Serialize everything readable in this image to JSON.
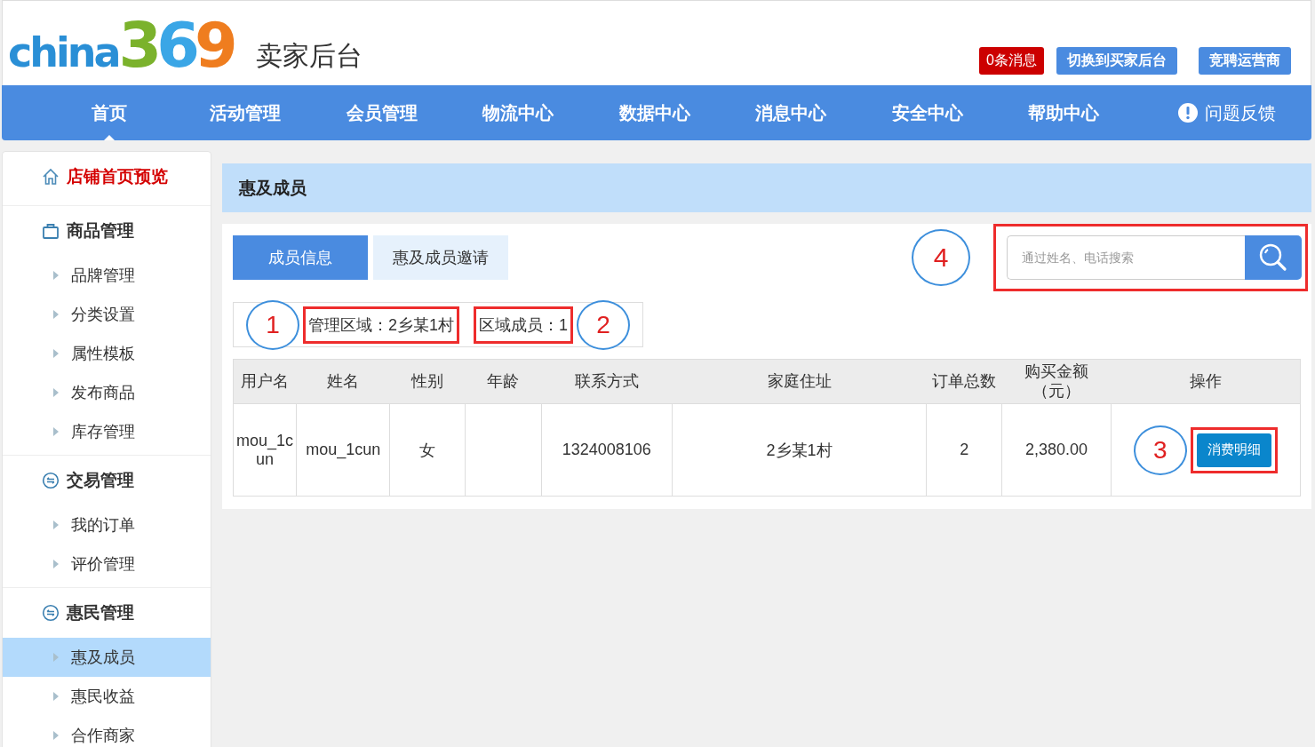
{
  "header": {
    "logo": "china369",
    "title": "卖家后台",
    "buttons": [
      {
        "label": "0条消息",
        "kind": "alert"
      },
      {
        "label": "切换到买家后台",
        "kind": "normal"
      },
      {
        "label": "竞聘运营商",
        "kind": "normal"
      }
    ]
  },
  "nav": {
    "items": [
      {
        "label": "首页",
        "selected": true
      },
      {
        "label": "活动管理",
        "selected": false
      },
      {
        "label": "会员管理",
        "selected": false
      },
      {
        "label": "物流中心",
        "selected": false
      },
      {
        "label": "数据中心",
        "selected": false
      },
      {
        "label": "消息中心",
        "selected": false
      },
      {
        "label": "安全中心",
        "selected": false
      },
      {
        "label": "帮助中心",
        "selected": false
      }
    ],
    "feedback": "问题反馈"
  },
  "sidebar": {
    "sections": [
      {
        "label": "店铺首页预览",
        "kind": "home"
      },
      {
        "label": "商品管理",
        "kind": "bag",
        "children": [
          {
            "label": "品牌管理",
            "selected": false
          },
          {
            "label": "分类设置",
            "selected": false
          },
          {
            "label": "属性模板",
            "selected": false
          },
          {
            "label": "发布商品",
            "selected": false
          },
          {
            "label": "库存管理",
            "selected": false
          }
        ]
      },
      {
        "label": "交易管理",
        "kind": "swap",
        "children": [
          {
            "label": "我的订单",
            "selected": false
          },
          {
            "label": "评价管理",
            "selected": false
          }
        ]
      },
      {
        "label": "惠民管理",
        "kind": "swap",
        "children": [
          {
            "label": "惠及成员",
            "selected": true
          },
          {
            "label": "惠民收益",
            "selected": false
          },
          {
            "label": "合作商家",
            "selected": false
          }
        ]
      }
    ]
  },
  "page_title": "惠及成员",
  "tabs": [
    {
      "label": "成员信息",
      "selected": true
    },
    {
      "label": "惠及成员邀请",
      "selected": false
    }
  ],
  "search": {
    "placeholder": "通过姓名、电话搜索",
    "marker": "4",
    "highlighted": true
  },
  "info": [
    {
      "text": "管理区域：2乡某1村",
      "marker": "1",
      "highlighted": true
    },
    {
      "text": "区域成员：1",
      "marker": "2",
      "highlighted": true
    }
  ],
  "table": {
    "columns": [
      "用户名",
      "姓名",
      "性别",
      "年龄",
      "联系方式",
      "家庭住址",
      "订单总数",
      "购买金额（元）",
      "操作"
    ],
    "rows": [
      {
        "cells": [
          "mou_1cun",
          "mou_1cun",
          "女",
          "",
          "1324008106",
          "2乡某1村",
          "2",
          "2,380.00"
        ],
        "action": "消费明细",
        "marker": "3",
        "highlighted": true
      }
    ]
  }
}
